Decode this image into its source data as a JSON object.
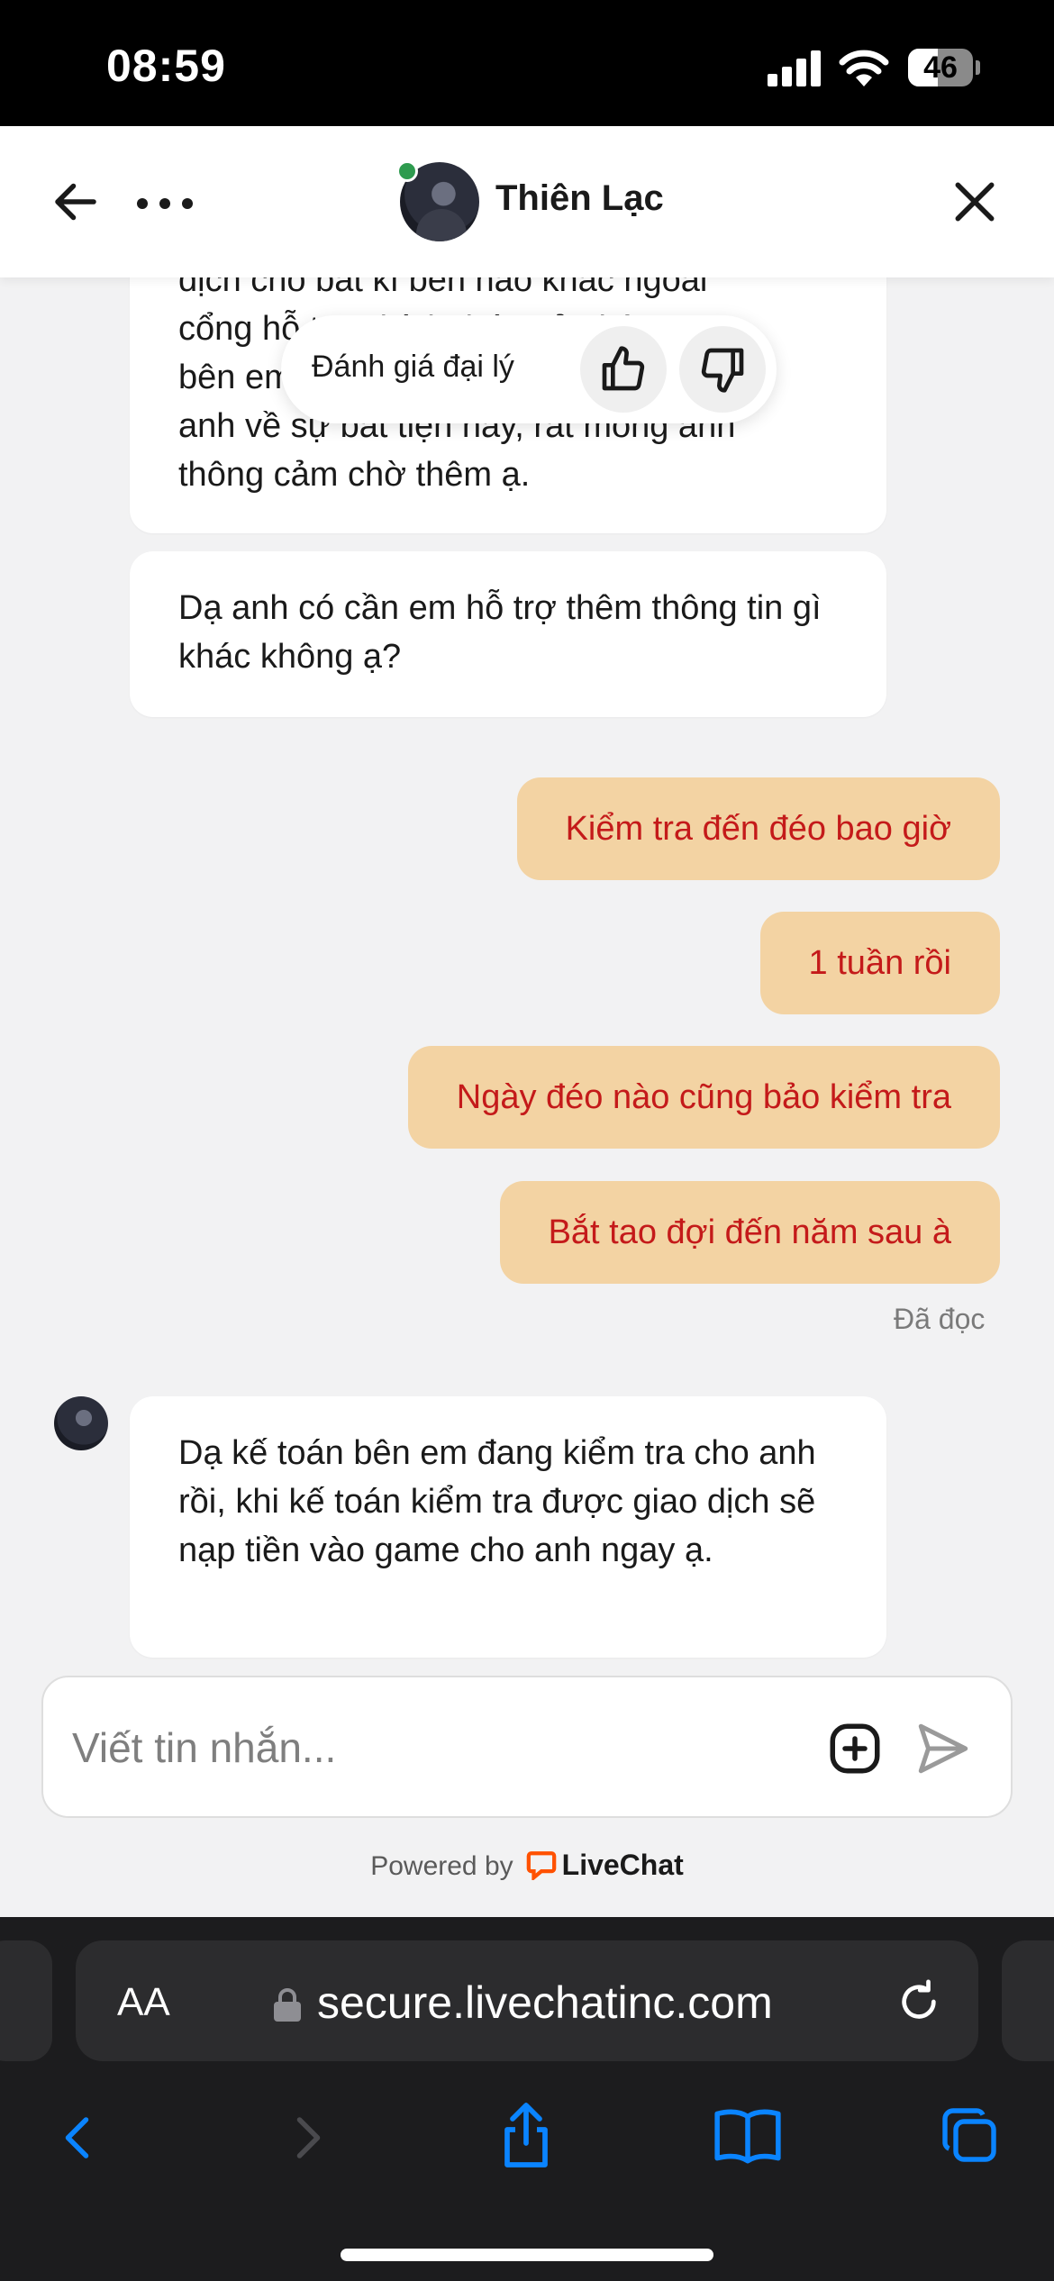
{
  "status_bar": {
    "time": "08:59",
    "battery": "46",
    "battery_level": 0.46
  },
  "header": {
    "agent_name": "Thiên Lạc"
  },
  "messages": {
    "incoming_1_lines": [
      "dịch cho bất kì bên nào khác ngoài",
      "cổng hỗ trợ chính thức của bên em",
      "bên em bên em thành thật xin lỗi",
      "anh về sự bất tiện này, rất mong anh",
      "thông cảm chờ thêm ạ."
    ],
    "incoming_2": "Dạ anh có cần em hỗ trợ thêm thông tin gì khác không ạ?",
    "outgoing": [
      "Kiểm tra đến đéo bao giờ",
      "1 tuần rồi",
      "Ngày đéo nào cũng bảo kiểm tra",
      "Bắt tao đợi đến năm sau à"
    ],
    "read_status": "Đã đọc",
    "incoming_3": "Dạ kế toán bên em đang kiểm tra cho anh rồi, khi kế toán kiểm tra được giao dịch sẽ nạp tiền vào game cho anh ngay ạ."
  },
  "rating": {
    "label": "Đánh giá đại lý"
  },
  "composer": {
    "placeholder": "Viết tin nhắn..."
  },
  "footer": {
    "powered_by": "Powered by",
    "brand": "LiveChat",
    "brand_color": "#ff5100"
  },
  "browser": {
    "aa": "AA",
    "url": "secure.livechatinc.com",
    "accent_color": "#0a84ff"
  },
  "icons": [
    "back-arrow-icon",
    "more-dots-icon",
    "close-icon",
    "thumbs-up-icon",
    "thumbs-down-icon",
    "add-attachment-icon",
    "send-icon",
    "lock-icon",
    "reload-icon",
    "browser-back-icon",
    "browser-forward-icon",
    "share-icon",
    "bookmarks-icon",
    "tabs-icon"
  ]
}
